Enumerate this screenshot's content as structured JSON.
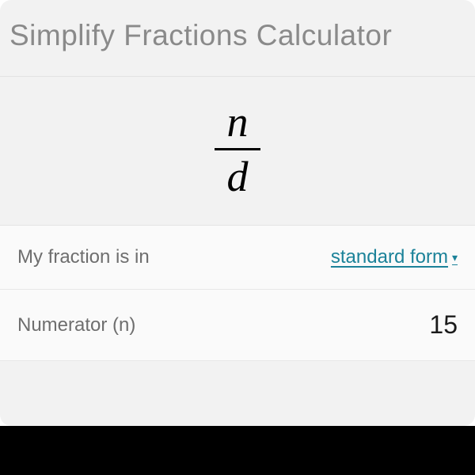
{
  "title": "Simplify Fractions Calculator",
  "fraction": {
    "numerator_symbol": "n",
    "denominator_symbol": "d"
  },
  "rows": {
    "fraction_form": {
      "label": "My fraction is in",
      "value": "standard form"
    },
    "numerator": {
      "label": "Numerator (n)",
      "value": "15"
    }
  }
}
